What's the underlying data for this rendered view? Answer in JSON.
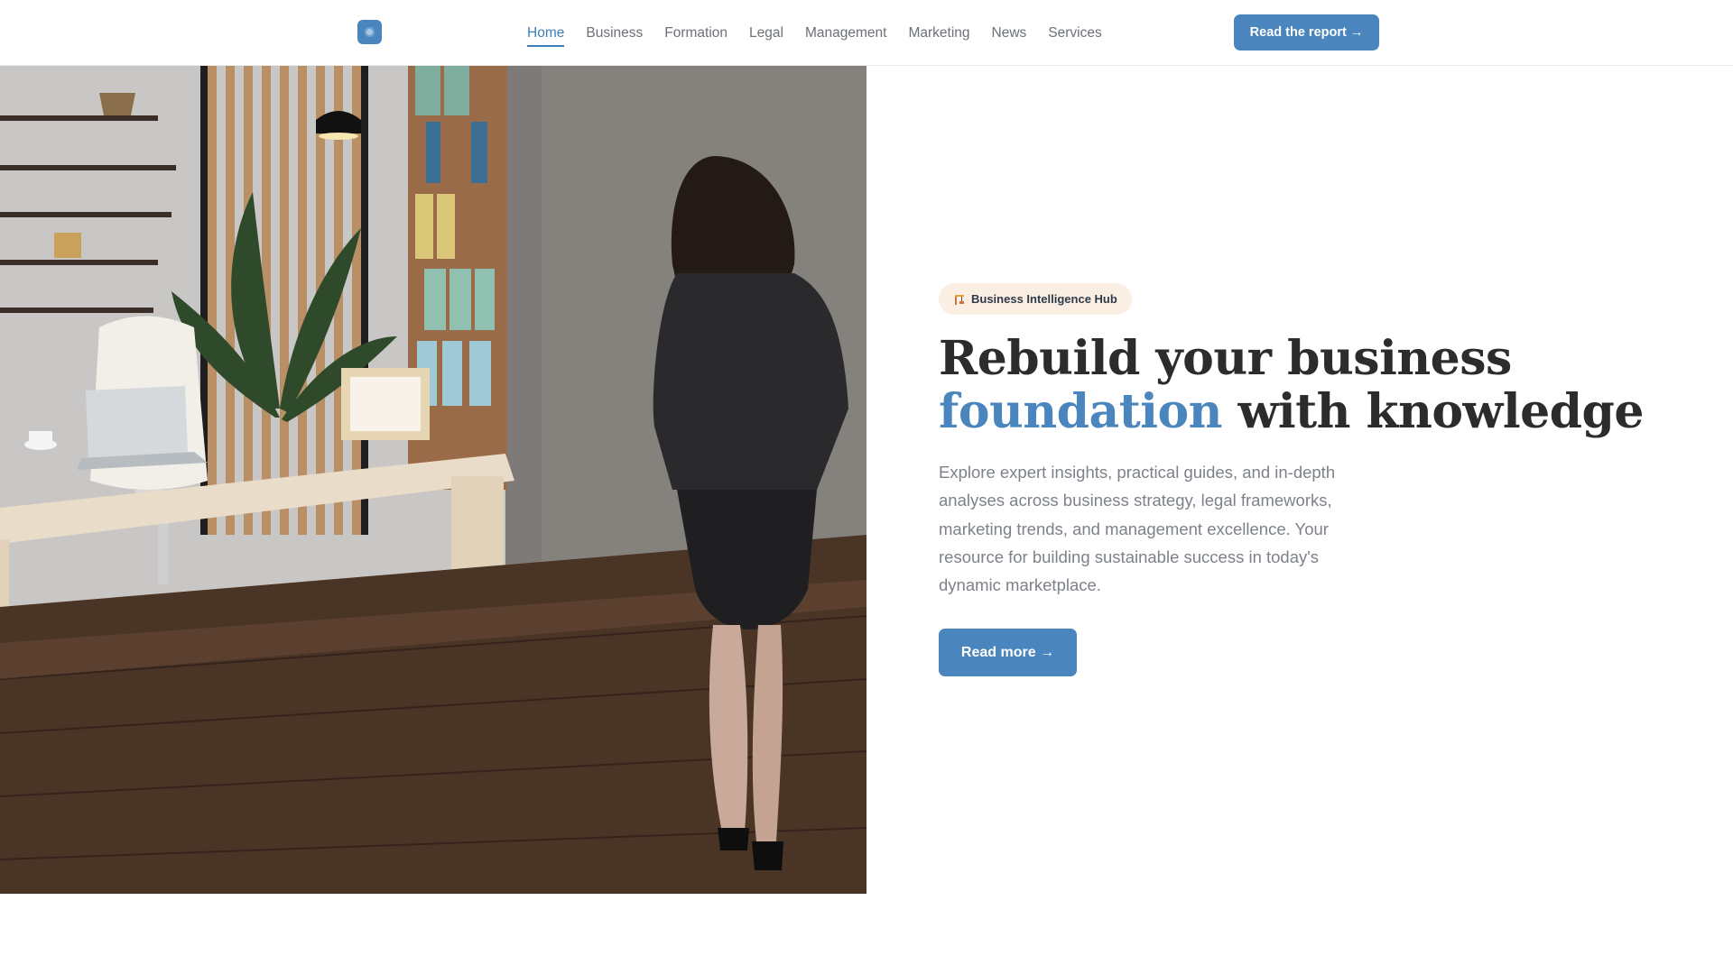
{
  "header": {
    "logo_icon": "logo-mark-icon",
    "nav": [
      {
        "label": "Home",
        "active": true
      },
      {
        "label": "Business",
        "active": false
      },
      {
        "label": "Formation",
        "active": false
      },
      {
        "label": "Legal",
        "active": false
      },
      {
        "label": "Management",
        "active": false
      },
      {
        "label": "Marketing",
        "active": false
      },
      {
        "label": "News",
        "active": false
      },
      {
        "label": "Services",
        "active": false
      }
    ],
    "cta_label": "Read the report →"
  },
  "hero": {
    "badge_icon": "construction-crane-icon",
    "badge_label": "Business Intelligence Hub",
    "headline_part1": "Rebuild your business ",
    "headline_accent": "foundation",
    "headline_part2": " with knowledge",
    "lead": "Explore expert insights, practical guides, and in-depth analyses across business strategy, legal frameworks, marketing trends, and management excellence. Your resource for building sustainable success in today's dynamic marketplace.",
    "button_label": "Read more →"
  },
  "colors": {
    "accent": "#4a86bd",
    "badge_bg": "#fbeee3",
    "heading": "#2c2c2c",
    "body_text": "#7d8189"
  }
}
